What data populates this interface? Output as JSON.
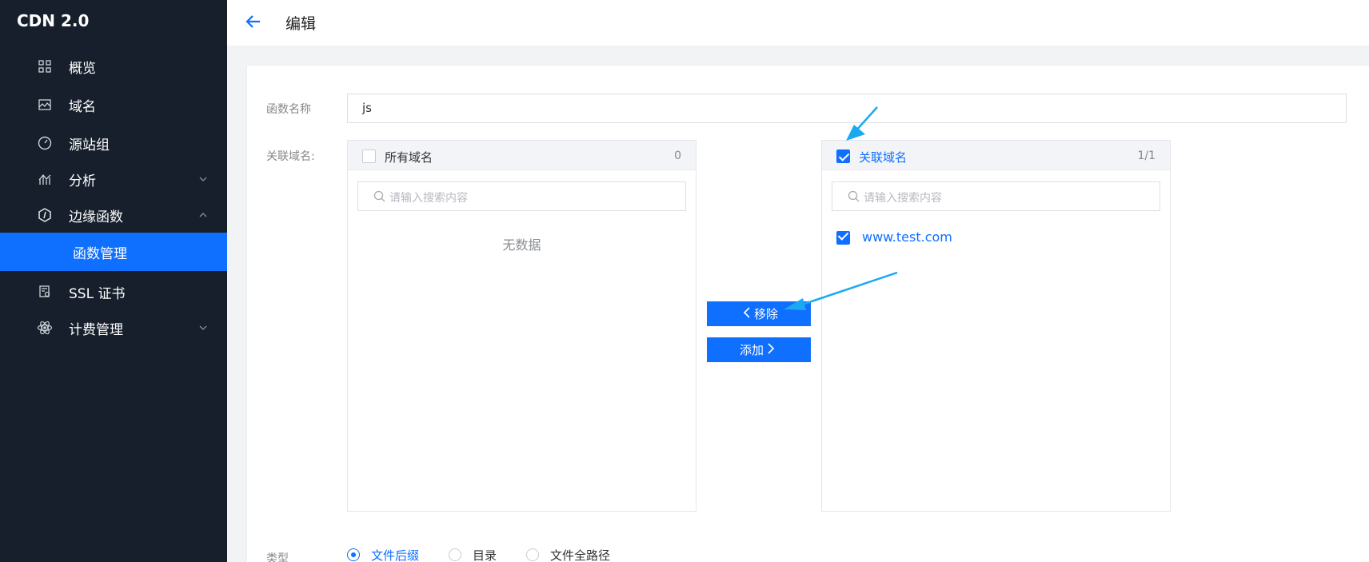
{
  "brand": "CDN 2.0",
  "sidebar": {
    "items": [
      {
        "label": "概览",
        "icon": "grid-icon"
      },
      {
        "label": "域名",
        "icon": "image-icon"
      },
      {
        "label": "源站组",
        "icon": "gauge-icon"
      },
      {
        "label": "分析",
        "icon": "chart-icon",
        "chevron": "down"
      },
      {
        "label": "边缘函数",
        "icon": "hexagon-icon",
        "chevron": "up"
      },
      {
        "label": "SSL 证书",
        "icon": "certificate-icon"
      },
      {
        "label": "计费管理",
        "icon": "atom-icon",
        "chevron": "down"
      }
    ],
    "active_sub": "函数管理"
  },
  "header": {
    "title": "编辑",
    "back_icon": "arrow-left-icon"
  },
  "form": {
    "name_label": "函数名称",
    "name_value": "js",
    "domain_label": "关联域名:",
    "type_label": "类型"
  },
  "left_panel": {
    "title": "所有域名",
    "count": "0",
    "search_placeholder": "请输入搜索内容",
    "empty_text": "无数据"
  },
  "right_panel": {
    "title": "关联域名",
    "count": "1/1",
    "search_placeholder": "请输入搜索内容",
    "items": [
      "www.test.com"
    ]
  },
  "transfer": {
    "remove_label": "移除",
    "add_label": "添加"
  },
  "type_options": [
    {
      "label": "文件后缀",
      "selected": true
    },
    {
      "label": "目录",
      "selected": false
    },
    {
      "label": "文件全路径",
      "selected": false
    }
  ],
  "colors": {
    "primary": "#0f6fff",
    "sidebar_bg": "#161f2b",
    "annotation": "#1aa9f0"
  }
}
